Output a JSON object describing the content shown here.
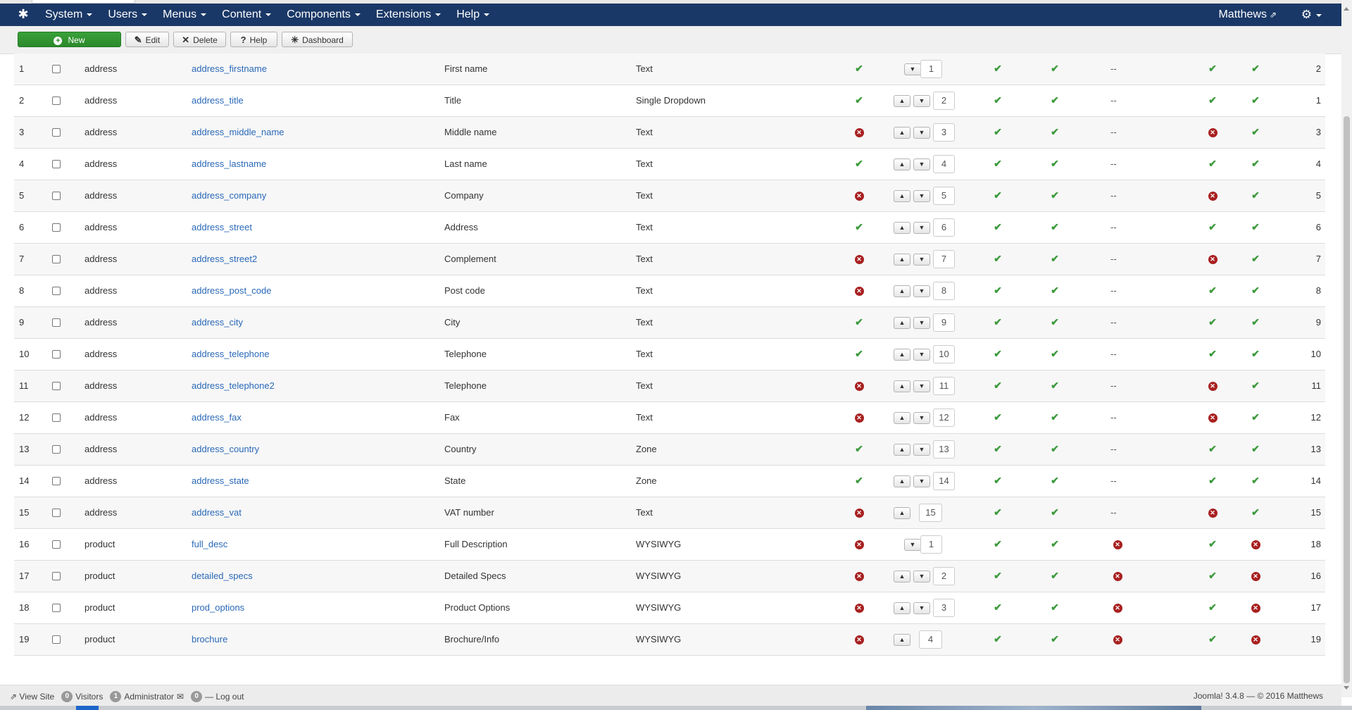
{
  "nav": {
    "menu": [
      "System",
      "Users",
      "Menus",
      "Content",
      "Components",
      "Extensions",
      "Help"
    ],
    "user": "Matthews"
  },
  "toolbar": {
    "new": "New",
    "edit": "Edit",
    "delete": "Delete",
    "help": "Help",
    "dashboard": "Dashboard"
  },
  "rows": [
    {
      "num": "1",
      "group": "address",
      "name": "address_firstname",
      "label": "First name",
      "type": "Text",
      "required": true,
      "up": false,
      "down": true,
      "order": "1",
      "c1": true,
      "c2": true,
      "d": "--",
      "c3": true,
      "c4": true,
      "id": "2"
    },
    {
      "num": "2",
      "group": "address",
      "name": "address_title",
      "label": "Title",
      "type": "Single Dropdown",
      "required": true,
      "up": true,
      "down": true,
      "order": "2",
      "c1": true,
      "c2": true,
      "d": "--",
      "c3": true,
      "c4": true,
      "id": "1"
    },
    {
      "num": "3",
      "group": "address",
      "name": "address_middle_name",
      "label": "Middle name",
      "type": "Text",
      "required": false,
      "up": true,
      "down": true,
      "order": "3",
      "c1": true,
      "c2": true,
      "d": "--",
      "c3": false,
      "c4": true,
      "id": "3"
    },
    {
      "num": "4",
      "group": "address",
      "name": "address_lastname",
      "label": "Last name",
      "type": "Text",
      "required": true,
      "up": true,
      "down": true,
      "order": "4",
      "c1": true,
      "c2": true,
      "d": "--",
      "c3": true,
      "c4": true,
      "id": "4"
    },
    {
      "num": "5",
      "group": "address",
      "name": "address_company",
      "label": "Company",
      "type": "Text",
      "required": false,
      "up": true,
      "down": true,
      "order": "5",
      "c1": true,
      "c2": true,
      "d": "--",
      "c3": false,
      "c4": true,
      "id": "5"
    },
    {
      "num": "6",
      "group": "address",
      "name": "address_street",
      "label": "Address",
      "type": "Text",
      "required": true,
      "up": true,
      "down": true,
      "order": "6",
      "c1": true,
      "c2": true,
      "d": "--",
      "c3": true,
      "c4": true,
      "id": "6"
    },
    {
      "num": "7",
      "group": "address",
      "name": "address_street2",
      "label": "Complement",
      "type": "Text",
      "required": false,
      "up": true,
      "down": true,
      "order": "7",
      "c1": true,
      "c2": true,
      "d": "--",
      "c3": false,
      "c4": true,
      "id": "7"
    },
    {
      "num": "8",
      "group": "address",
      "name": "address_post_code",
      "label": "Post code",
      "type": "Text",
      "required": false,
      "up": true,
      "down": true,
      "order": "8",
      "c1": true,
      "c2": true,
      "d": "--",
      "c3": true,
      "c4": true,
      "id": "8"
    },
    {
      "num": "9",
      "group": "address",
      "name": "address_city",
      "label": "City",
      "type": "Text",
      "required": true,
      "up": true,
      "down": true,
      "order": "9",
      "c1": true,
      "c2": true,
      "d": "--",
      "c3": true,
      "c4": true,
      "id": "9"
    },
    {
      "num": "10",
      "group": "address",
      "name": "address_telephone",
      "label": "Telephone",
      "type": "Text",
      "required": true,
      "up": true,
      "down": true,
      "order": "10",
      "c1": true,
      "c2": true,
      "d": "--",
      "c3": true,
      "c4": true,
      "id": "10"
    },
    {
      "num": "11",
      "group": "address",
      "name": "address_telephone2",
      "label": "Telephone",
      "type": "Text",
      "required": false,
      "up": true,
      "down": true,
      "order": "11",
      "c1": true,
      "c2": true,
      "d": "--",
      "c3": false,
      "c4": true,
      "id": "11"
    },
    {
      "num": "12",
      "group": "address",
      "name": "address_fax",
      "label": "Fax",
      "type": "Text",
      "required": false,
      "up": true,
      "down": true,
      "order": "12",
      "c1": true,
      "c2": true,
      "d": "--",
      "c3": false,
      "c4": true,
      "id": "12"
    },
    {
      "num": "13",
      "group": "address",
      "name": "address_country",
      "label": "Country",
      "type": "Zone",
      "required": true,
      "up": true,
      "down": true,
      "order": "13",
      "c1": true,
      "c2": true,
      "d": "--",
      "c3": true,
      "c4": true,
      "id": "13"
    },
    {
      "num": "14",
      "group": "address",
      "name": "address_state",
      "label": "State",
      "type": "Zone",
      "required": true,
      "up": true,
      "down": true,
      "order": "14",
      "c1": true,
      "c2": true,
      "d": "--",
      "c3": true,
      "c4": true,
      "id": "14"
    },
    {
      "num": "15",
      "group": "address",
      "name": "address_vat",
      "label": "VAT number",
      "type": "Text",
      "required": false,
      "up": true,
      "down": false,
      "order": "15",
      "c1": true,
      "c2": true,
      "d": "--",
      "c3": false,
      "c4": true,
      "id": "15"
    },
    {
      "num": "16",
      "group": "product",
      "name": "full_desc",
      "label": "Full Description",
      "type": "WYSIWYG",
      "required": false,
      "up": false,
      "down": true,
      "order": "1",
      "c1": true,
      "c2": true,
      "d": "x",
      "c3": true,
      "c4": false,
      "id": "18"
    },
    {
      "num": "17",
      "group": "product",
      "name": "detailed_specs",
      "label": "Detailed Specs",
      "type": "WYSIWYG",
      "required": false,
      "up": true,
      "down": true,
      "order": "2",
      "c1": true,
      "c2": true,
      "d": "x",
      "c3": true,
      "c4": false,
      "id": "16"
    },
    {
      "num": "18",
      "group": "product",
      "name": "prod_options",
      "label": "Product Options",
      "type": "WYSIWYG",
      "required": false,
      "up": true,
      "down": true,
      "order": "3",
      "c1": true,
      "c2": true,
      "d": "x",
      "c3": true,
      "c4": false,
      "id": "17"
    },
    {
      "num": "19",
      "group": "product",
      "name": "brochure",
      "label": "Brochure/Info",
      "type": "WYSIWYG",
      "required": false,
      "up": true,
      "down": false,
      "order": "4",
      "c1": true,
      "c2": true,
      "d": "x",
      "c3": true,
      "c4": false,
      "id": "19"
    }
  ],
  "footer": {
    "view_site": "View Site",
    "visitors_count": "0",
    "visitors": "Visitors",
    "admin_count": "1",
    "admin": "Administrator",
    "messages_count": "0",
    "logout": "Log out",
    "version": "Joomla! 3.4.8  —  © 2016 Matthews"
  }
}
